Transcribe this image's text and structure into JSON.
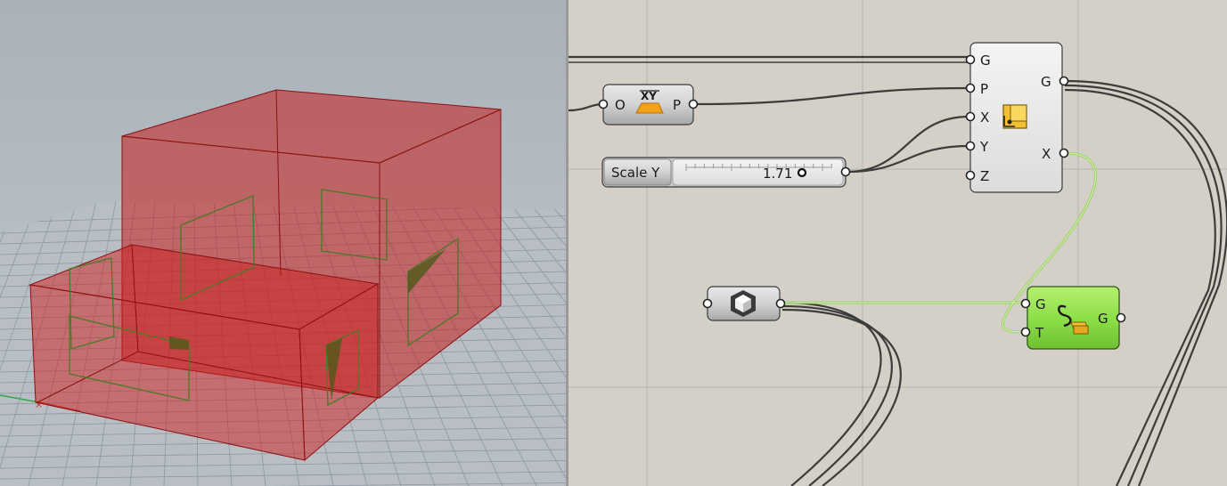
{
  "viewport": {
    "grid_color": "#8d97a0",
    "box_color": "#cc1f1f",
    "outline_color": "#3e7a2a"
  },
  "canvas": {
    "background": "#d4d0c8",
    "wire_color": "#3c3c3a",
    "selected_wire_color": "#8fd14f",
    "xy_plane": {
      "input_label": "O",
      "output_label": "P"
    },
    "slider": {
      "name": "Scale Y",
      "value": "1.71",
      "fill_fraction": 0.71
    },
    "scale_nu": {
      "inputs": [
        "G",
        "P",
        "X",
        "Y",
        "Z"
      ],
      "outputs": [
        "G",
        "X"
      ]
    },
    "geometry_param": {
      "icon": "hexagon-cube-icon"
    },
    "transform": {
      "inputs": [
        "G",
        "T"
      ],
      "output": "G",
      "color": "#8ee04a"
    }
  }
}
